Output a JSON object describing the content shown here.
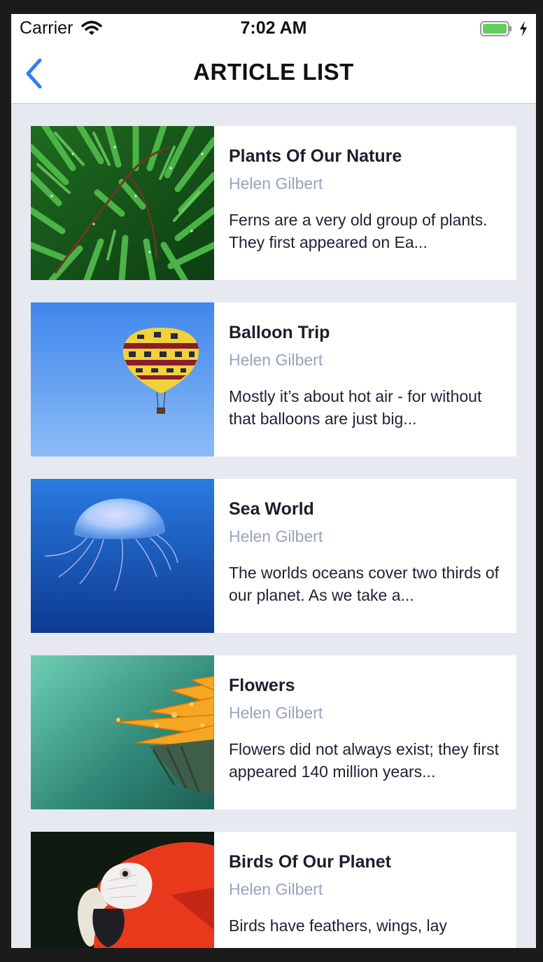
{
  "status_bar": {
    "carrier": "Carrier",
    "time": "7:02 AM",
    "battery_color": "#62cf5e"
  },
  "nav": {
    "title": "ARTICLE LIST",
    "back_icon": "chevron-left-icon",
    "accent": "#2f7cf6"
  },
  "articles": [
    {
      "title": "Plants Of Our Nature",
      "author": "Helen Gilbert",
      "excerpt": "Ferns are a very old group of plants. They first appeared on Ea...",
      "image": "fern-leaves-image"
    },
    {
      "title": "Balloon Trip",
      "author": "Helen Gilbert",
      "excerpt": "Mostly it’s about hot air - for without that balloons are just big...",
      "image": "hot-air-balloon-image"
    },
    {
      "title": "Sea World",
      "author": "Helen Gilbert",
      "excerpt": "The worlds oceans cover two thirds of our planet. As we take a...",
      "image": "jellyfish-image"
    },
    {
      "title": "Flowers",
      "author": "Helen Gilbert",
      "excerpt": "Flowers did not always exist; they first appeared 140 million years...",
      "image": "orange-flower-image"
    },
    {
      "title": "Birds Of Our Planet",
      "author": "Helen Gilbert",
      "excerpt": "Birds have feathers, wings, lay",
      "image": "macaw-parrot-image"
    }
  ]
}
